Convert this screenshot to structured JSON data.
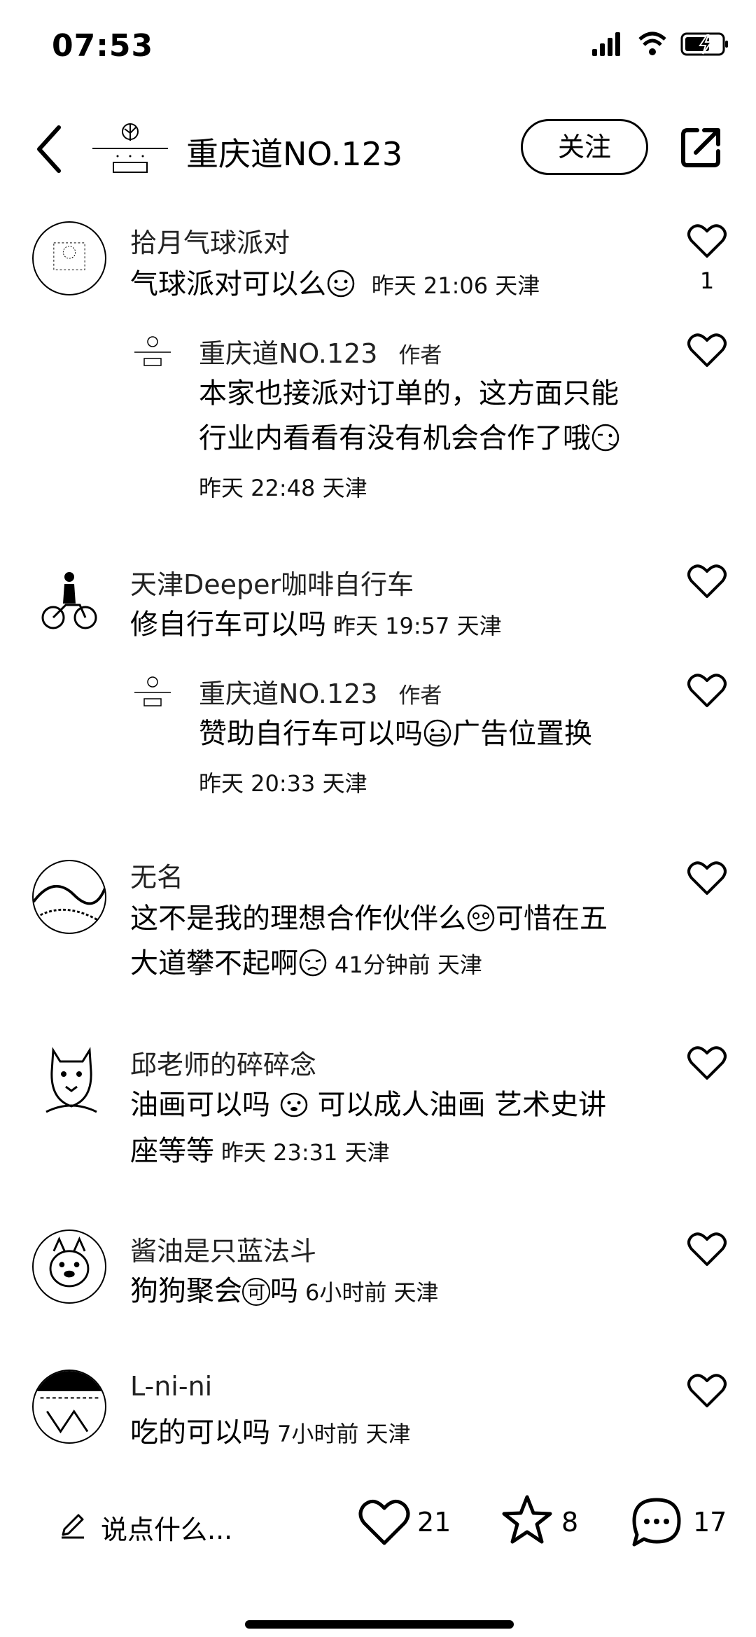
{
  "status": {
    "time": "07:53"
  },
  "header": {
    "title": "重庆道NO.123",
    "follow_label": "关注"
  },
  "comments": [
    {
      "name": "拾月气球派对",
      "text": "气球派对可以么",
      "emoji": "smile-emoji",
      "meta": "昨天 21:06 天津",
      "likes": "1",
      "reply": {
        "name": "重庆道NO.123",
        "tag": "作者",
        "line1": "本家也接派对订单的，这方面只能",
        "line2": "行业内看看有没有机会合作了哦",
        "emoji": "wink-emoji",
        "meta": "昨天 22:48 天津"
      }
    },
    {
      "name": "天津Deeper咖啡自行车",
      "text": "修自行车可以吗",
      "meta": "昨天 19:57 天津",
      "reply": {
        "name": "重庆道NO.123",
        "tag": "作者",
        "line1a": "赞助自行车可以吗",
        "line1b": "广告位置换",
        "emoji": "grin-emoji",
        "meta": "昨天 20:33 天津"
      }
    },
    {
      "name": "无名",
      "line1a": "这不是我的理想合作伙伴么",
      "line1b": "可惜在五",
      "line2": "大道攀不起啊",
      "meta": "41分钟前 天津"
    },
    {
      "name": "邱老师的碎碎念",
      "line1a": "油画可以吗",
      "line1b": "可以成人油画 艺术史讲",
      "line2": "座等等",
      "meta": "昨天 23:31 天津"
    },
    {
      "name": "酱油是只蓝法斗",
      "text_a": "狗狗聚会",
      "text_b": "吗",
      "sticker": "可",
      "meta": "6小时前 天津"
    },
    {
      "name": "L-ni-ni",
      "text": "吃的可以吗",
      "meta": "7小时前 天津"
    }
  ],
  "bottom": {
    "input_placeholder": "说点什么...",
    "likes": "21",
    "stars": "8",
    "comments": "17"
  }
}
